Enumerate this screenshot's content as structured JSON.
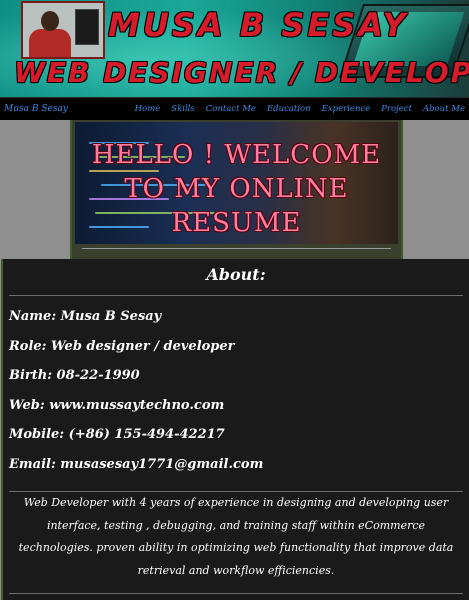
{
  "banner": {
    "name": "MUSA B SESAY",
    "role": "WEB DESIGNER / DEVELOPER"
  },
  "navbar": {
    "brand": "Musa B Sesay",
    "links": [
      "Home",
      "Skills",
      "Contact Me",
      "Education",
      "Experience",
      "Project",
      "About Me"
    ],
    "link_color": "#3e8de6"
  },
  "hero": {
    "line1": "HELLO ! WELCOME",
    "line2": "TO MY ONLINE RESUME"
  },
  "about": {
    "title": "About:",
    "name": "Name: Musa B Sesay",
    "role": "Role: Web designer / developer",
    "birth": "Birth: 08-22-1990",
    "web": "Web: www.mussaytechno.com",
    "mobile": "Mobile: (+86) 155-494-42217",
    "email": "Email: musasesay1771@gmail.com",
    "summary": "Web Developer with 4 years of experience in designing and developing user interface, testing , debugging, and training staff within eCommerce technologies. proven ability in optimizing web functionality that improve data retrieval and workflow efficiencies."
  },
  "colors": {
    "banner_text": "#d61c2a",
    "hero_text": "#ff7ea0",
    "page_bg": "#8f8f8f",
    "panel_bg": "#1a1a1a"
  }
}
